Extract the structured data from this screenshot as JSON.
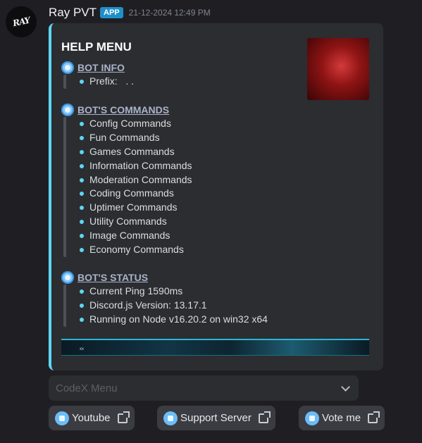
{
  "message": {
    "username": "Ray PVT",
    "badge": "APP",
    "timestamp": "21-12-2024 12:49 PM",
    "avatar_text": "RAY"
  },
  "embed": {
    "title": "HELP MENU",
    "accent_color": "#5fd6f5",
    "sections": [
      {
        "label": "BOT INFO",
        "icon": "gear-icon",
        "items": [
          "Prefix:   . ."
        ]
      },
      {
        "label": "BOT'S COMMANDS",
        "icon": "gear-icon",
        "items": [
          "Config Commands",
          "Fun Commands",
          "Games Commands",
          "Information Commands",
          "Moderation Commands",
          "Coding Commands",
          "Uptimer Commands",
          "Utility Commands",
          "Image Commands",
          "Economy Commands"
        ]
      },
      {
        "label": "BOT'S STATUS",
        "icon": "gear-icon",
        "items": [
          "Current Ping 1590ms",
          "Discord.js Version: 13.17.1",
          "Running on Node v16.20.2 on win32 x64"
        ]
      }
    ],
    "banner_text": "xx"
  },
  "select_menu": {
    "placeholder": "CodeX Menu"
  },
  "buttons": [
    {
      "label": "Youtube",
      "icon": "youtube-icon"
    },
    {
      "label": "Support Server",
      "icon": "support-icon"
    },
    {
      "label": "Vote me",
      "icon": "vote-icon"
    }
  ]
}
